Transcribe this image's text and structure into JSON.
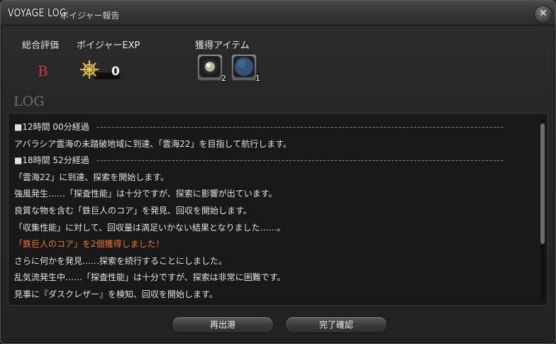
{
  "window": {
    "title": "VOYAGE LOG",
    "subtitle": "ボイジャー報告",
    "close_symbol": "✕"
  },
  "summary": {
    "grade_label": "総合評価",
    "grade_value": "B",
    "exp_label": "ボイジャーEXP",
    "exp_value": "0",
    "exp_icon": "ship-wheel-icon",
    "items_label": "獲得アイテム",
    "items": [
      {
        "icon": "pearl-item-icon",
        "count": "2",
        "color": "#c9c2a8"
      },
      {
        "icon": "blue-orb-item-icon",
        "count": "1",
        "color": "#3a5a8a"
      }
    ]
  },
  "log": {
    "heading": "LOG",
    "lines": [
      {
        "text": "■12時間 00分経過",
        "rule": "------------------------------------------------------------------------------------------------------------"
      },
      {
        "text": "アバラシア雲海の未踏破地域に到達、「雲海22」を目指して航行します。"
      },
      {
        "text": "■18時間 52分経過",
        "rule": "------------------------------------------------------------------------------------------------------------"
      },
      {
        "text": "「雲海22」に到達、探索を開始します。"
      },
      {
        "text": "強風発生……「探査性能」は十分ですが、探索に影響が出ています。"
      },
      {
        "text": "良質な物を含む「鉄巨人のコア」を発見、回収を開始します。"
      },
      {
        "text": "「収集性能」に対して、回収量は満足いかない結果となりました……。"
      },
      {
        "text": "「鉄巨人のコア」を2個獲得しました！",
        "highlight": true
      },
      {
        "text": "さらに何かを発見……探索を続行することにしました。"
      },
      {
        "text": "乱気流発生中……「探査性能」は十分ですが、探索は非常に困難です。"
      },
      {
        "text": "見事に『ダスクレザー』を検知、回収を開始します。"
      }
    ]
  },
  "buttons": {
    "redeploy": "再出港",
    "finalize": "完了確認"
  },
  "colors": {
    "grade": "#d8333a",
    "highlight": "#f07830"
  }
}
